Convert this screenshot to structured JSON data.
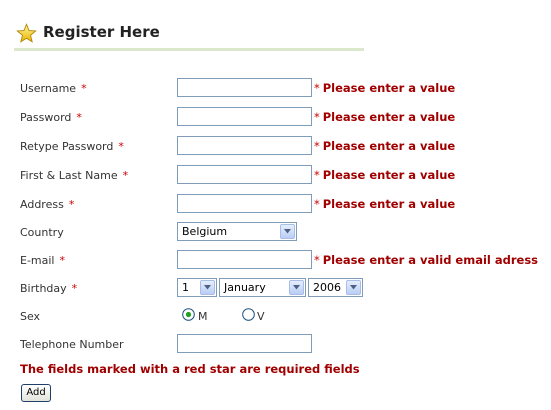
{
  "header": {
    "title": "Register Here",
    "icon": "star-icon"
  },
  "required_mark": "*",
  "fields": {
    "username": {
      "label": "Username",
      "value": "",
      "error": "Please enter a value"
    },
    "password": {
      "label": "Password",
      "value": "",
      "error": "Please enter a value"
    },
    "retype_password": {
      "label": "Retype Password",
      "value": "",
      "error": "Please enter a value"
    },
    "name": {
      "label": "First & Last Name",
      "value": "",
      "error": "Please enter a value"
    },
    "address": {
      "label": "Address",
      "value": "",
      "error": "Please enter a value"
    },
    "country": {
      "label": "Country",
      "selected": "Belgium"
    },
    "email": {
      "label": "E-mail",
      "value": "",
      "error": "Please enter a valid email adress"
    },
    "birthday": {
      "label": "Birthday",
      "day": "1",
      "month": "January",
      "year": "2006"
    },
    "sex": {
      "label": "Sex",
      "options": [
        "M",
        "V"
      ],
      "selected": "M"
    },
    "telephone": {
      "label": "Telephone Number",
      "value": ""
    }
  },
  "footnote": "The fields marked with  a red star are required fields",
  "add_button": "Add",
  "colors": {
    "error": "#a10000",
    "required": "#cc0000",
    "title": "#222222",
    "rule": "#dbe8cc"
  }
}
